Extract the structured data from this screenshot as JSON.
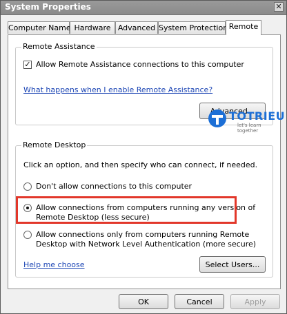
{
  "window": {
    "title": "System Properties",
    "close_glyph": "✕"
  },
  "tabs": [
    {
      "label": "Computer Name"
    },
    {
      "label": "Hardware"
    },
    {
      "label": "Advanced"
    },
    {
      "label": "System Protection"
    },
    {
      "label": "Remote",
      "active": true
    }
  ],
  "remote_assistance": {
    "group_title": "Remote Assistance",
    "checkbox_label": "Allow Remote Assistance connections to this computer",
    "checkbox_checked": true,
    "check_glyph": "✓",
    "help_link": "What happens when I enable Remote Assistance?",
    "advanced_button": "Advanced..."
  },
  "remote_desktop": {
    "group_title": "Remote Desktop",
    "instructions": "Click an option, and then specify who can connect, if needed.",
    "options": [
      {
        "label": "Don't allow connections to this computer",
        "selected": false
      },
      {
        "label_line1": "Allow connections from computers running any version of",
        "label_line2": "Remote Desktop (less secure)",
        "selected": true
      },
      {
        "label_line1": "Allow connections only from computers running Remote",
        "label_line2": "Desktop with Network Level Authentication (more secure)",
        "selected": false
      }
    ],
    "help_link": "Help me choose",
    "select_users_button": "Select Users..."
  },
  "footer": {
    "ok": "OK",
    "cancel": "Cancel",
    "apply": "Apply",
    "apply_enabled": false
  },
  "watermark": {
    "brand": "TOTRIEU",
    "tagline": "let's learn together",
    "color": "#1c6fd6"
  },
  "annotation": {
    "color": "#e2372a"
  }
}
